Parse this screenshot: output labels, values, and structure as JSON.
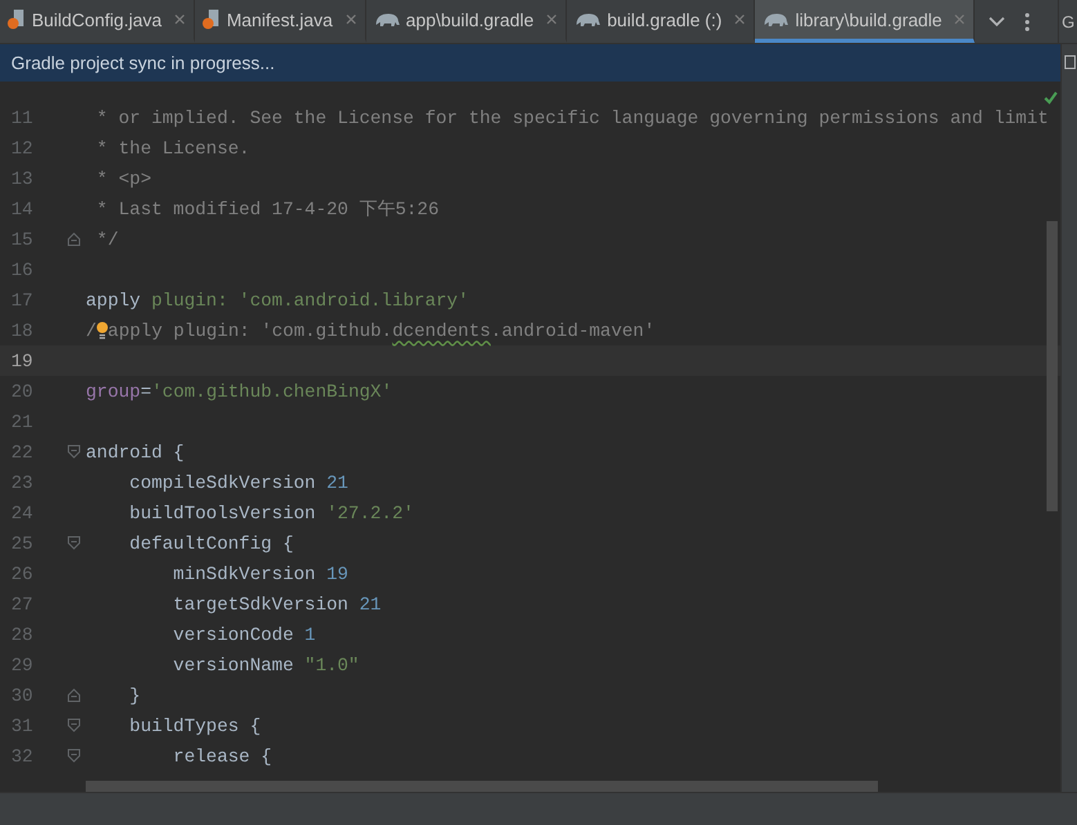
{
  "tabs": [
    {
      "label": "BuildConfig.java",
      "kind": "java",
      "selected": false
    },
    {
      "label": "Manifest.java",
      "kind": "java",
      "selected": false
    },
    {
      "label": "app\\build.gradle",
      "kind": "gradle",
      "selected": false
    },
    {
      "label": "build.gradle (:)",
      "kind": "gradle",
      "selected": false
    },
    {
      "label": "library\\build.gradle",
      "kind": "gradle",
      "selected": true
    }
  ],
  "side_tab": "G",
  "notification": "Gradle project sync in progress...",
  "lines": [
    {
      "number": "11",
      "current": false,
      "tokens": [
        {
          "text": " * or implied. See the License for the specific language governing permissions and limit",
          "kind": "comment"
        }
      ]
    },
    {
      "number": "12",
      "current": false,
      "tokens": [
        {
          "text": " * the License.",
          "kind": "comment"
        }
      ]
    },
    {
      "number": "13",
      "current": false,
      "tokens": [
        {
          "text": " * <p>",
          "kind": "comment"
        }
      ]
    },
    {
      "number": "14",
      "current": false,
      "tokens": [
        {
          "text": " * Last modified 17-4-20 下午5:26",
          "kind": "comment"
        }
      ]
    },
    {
      "number": "15",
      "current": false,
      "fold_end": true,
      "tokens": [
        {
          "text": " */",
          "kind": "comment"
        }
      ]
    },
    {
      "number": "16",
      "current": false
    },
    {
      "number": "17",
      "current": false,
      "tokens": [
        {
          "text": "apply",
          "kind": "plain"
        },
        {
          "text": " plugin:",
          "kind": "label"
        },
        {
          "text": " 'com.android.library'",
          "kind": "string"
        }
      ]
    },
    {
      "number": "18",
      "current": false,
      "tokens": [
        {
          "text": "/",
          "kind": "comment"
        },
        {
          "kind": "bulb"
        },
        {
          "text": "apply plugin: 'com.github.",
          "kind": "comment"
        },
        {
          "text": "dcendents",
          "kind": "typo"
        },
        {
          "text": ".android-maven'",
          "kind": "comment"
        }
      ]
    },
    {
      "number": "19",
      "current": true
    },
    {
      "number": "20",
      "current": false,
      "tokens": [
        {
          "text": "group",
          "kind": "property"
        },
        {
          "text": "=",
          "kind": "plain"
        },
        {
          "text": "'com.github.chenBingX'",
          "kind": "string"
        }
      ]
    },
    {
      "number": "21",
      "current": false
    },
    {
      "number": "22",
      "current": false,
      "fold_start": true,
      "tokens": [
        {
          "text": "android {",
          "kind": "plain"
        }
      ]
    },
    {
      "number": "23",
      "current": false,
      "tokens": [
        {
          "text": "    compileSdkVersion ",
          "kind": "plain"
        },
        {
          "text": "21",
          "kind": "number"
        }
      ]
    },
    {
      "number": "24",
      "current": false,
      "tokens": [
        {
          "text": "    buildToolsVersion ",
          "kind": "plain"
        },
        {
          "text": "'27.2.2'",
          "kind": "string"
        }
      ]
    },
    {
      "number": "25",
      "current": false,
      "fold_start": true,
      "tokens": [
        {
          "text": "    defaultConfig {",
          "kind": "plain"
        }
      ]
    },
    {
      "number": "26",
      "current": false,
      "tokens": [
        {
          "text": "        minSdkVersion ",
          "kind": "plain"
        },
        {
          "text": "19",
          "kind": "number"
        }
      ]
    },
    {
      "number": "27",
      "current": false,
      "tokens": [
        {
          "text": "        targetSdkVersion ",
          "kind": "plain"
        },
        {
          "text": "21",
          "kind": "number"
        }
      ]
    },
    {
      "number": "28",
      "current": false,
      "tokens": [
        {
          "text": "        versionCode ",
          "kind": "plain"
        },
        {
          "text": "1",
          "kind": "number"
        }
      ]
    },
    {
      "number": "29",
      "current": false,
      "tokens": [
        {
          "text": "        versionName ",
          "kind": "plain"
        },
        {
          "text": "\"1.0\"",
          "kind": "string"
        }
      ]
    },
    {
      "number": "30",
      "current": false,
      "fold_end": true,
      "tokens": [
        {
          "text": "    }",
          "kind": "plain"
        }
      ]
    },
    {
      "number": "31",
      "current": false,
      "fold_start": true,
      "tokens": [
        {
          "text": "    buildTypes {",
          "kind": "plain"
        }
      ]
    },
    {
      "number": "32",
      "current": false,
      "fold_start": true,
      "tokens": [
        {
          "text": "        release {",
          "kind": "plain"
        }
      ]
    }
  ]
}
